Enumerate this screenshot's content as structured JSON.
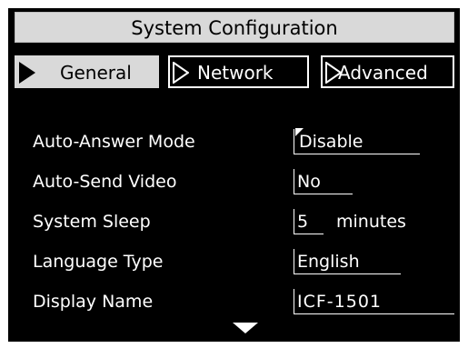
{
  "window": {
    "title": "System Configuration"
  },
  "tabs": [
    {
      "label": "General",
      "active": true
    },
    {
      "label": "Network",
      "active": false
    },
    {
      "label": "Advanced",
      "active": false
    }
  ],
  "settings": [
    {
      "label": "Auto-Answer Mode",
      "value": "Disable"
    },
    {
      "label": "Auto-Send Video",
      "value": "No"
    },
    {
      "label": "System Sleep",
      "value": "5",
      "unit": "minutes"
    },
    {
      "label": "Language Type",
      "value": "English"
    },
    {
      "label": "Display Name",
      "value": "ICF-1501"
    }
  ],
  "icons": {
    "tab_arrow": "play-triangle-icon",
    "scroll": "chevron-down-icon"
  },
  "colors": {
    "background": "#000000",
    "panel": "#d9d9d9",
    "text": "#ffffff"
  }
}
